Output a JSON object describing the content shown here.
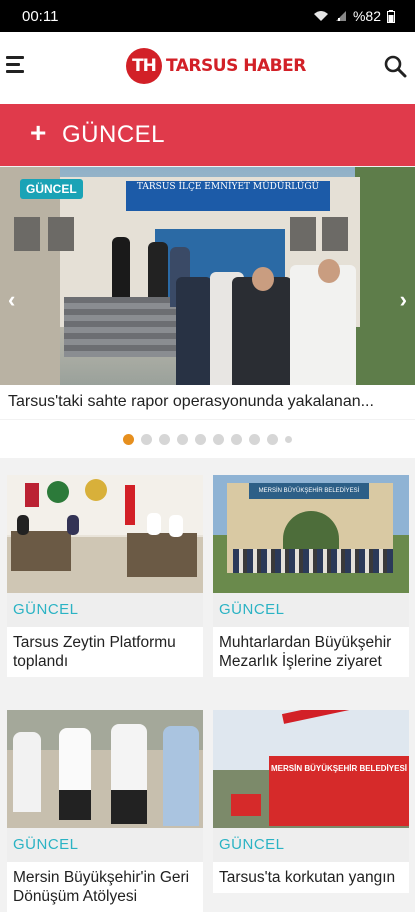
{
  "status_bar": {
    "time": "00:11",
    "battery": "%82"
  },
  "app": {
    "logo_mark": "TH",
    "logo_text": "TARSUS HABER"
  },
  "section": {
    "icon": "+",
    "title": "GÜNCEL"
  },
  "slider": {
    "badge": "GÜNCEL",
    "sign_text": "TARSUS İLÇE EMNİYET MÜDÜRLÜĞÜ",
    "caption": "Tarsus'taki sahte rapor operasyonunda yakalanan...",
    "dot_count": 10,
    "active_dot": 1
  },
  "cards": [
    {
      "category": "GÜNCEL",
      "title": "Tarsus Zeytin Platformu toplandı"
    },
    {
      "category": "GÜNCEL",
      "title": "Muhtarlardan Büyükşehir Mezarlık İşlerine ziyaret",
      "sign_text": "MERSİN BÜYÜKŞEHİR BELEDİYESİ"
    },
    {
      "category": "GÜNCEL",
      "title": "Mersin Büyükşehir'in Geri Dönüşüm Atölyesi"
    },
    {
      "category": "GÜNCEL",
      "title": "Tarsus'ta korkutan yangın",
      "truck_text": "MERSİN BÜYÜKŞEHİR BELEDİYESİ"
    }
  ],
  "colors": {
    "brand_red": "#d22027",
    "section_bar": "#e03a4b",
    "category_teal": "#2bb3c4",
    "active_dot": "#e68f1e"
  }
}
